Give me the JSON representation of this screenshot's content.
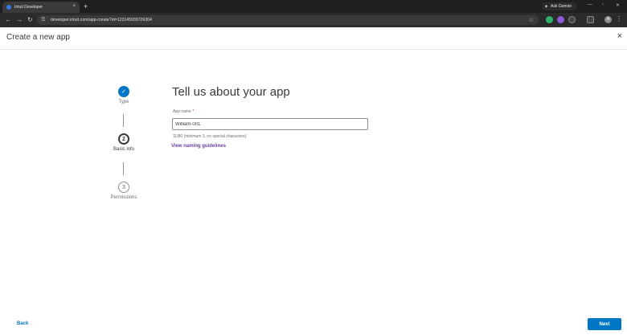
{
  "browser": {
    "tab_title": "Intuit Developer",
    "tab_close": "×",
    "new_tab": "+",
    "url": "developer.intuit.com/app-create?id=123145939726304",
    "gemini_label": "Ask Gemini",
    "profile_initial": "A"
  },
  "header": {
    "title": "Create a new app",
    "close": "×"
  },
  "stepper": {
    "steps": [
      {
        "num": "✓",
        "label": "Type"
      },
      {
        "num": "2",
        "label": "Basic info"
      },
      {
        "num": "3",
        "label": "Permissions"
      }
    ]
  },
  "form": {
    "heading": "Tell us about your app",
    "label": "App name",
    "required": "*",
    "value": "William-001",
    "hint": "11/80 (minimum 3, no special characters)",
    "link": "View naming guidelines"
  },
  "footer": {
    "back": "Back",
    "next": "Next"
  }
}
